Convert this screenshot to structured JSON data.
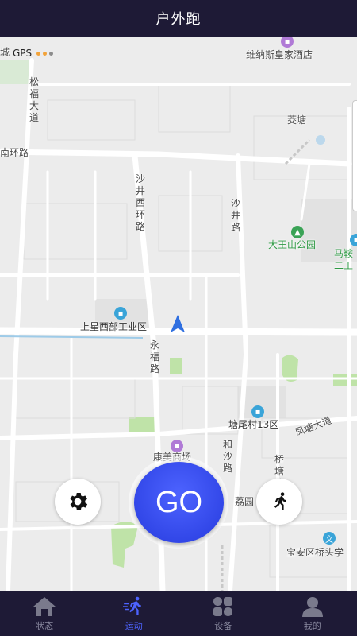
{
  "header": {
    "title": "户外跑"
  },
  "gps": {
    "label": "GPS",
    "dots": [
      "#f2a33a",
      "#f2a33a",
      "#8c8c8c"
    ]
  },
  "map": {
    "labels": {
      "hotel": "维纳斯皇家酒店",
      "songfu": "松福大道",
      "jiaotang": "茭塘",
      "nanhuan": "南环路",
      "shajingxihuan": "沙井西环路",
      "shajinglu": "沙井路",
      "dawangshan": "大王山公园",
      "maan": "马鞍",
      "er": "二工",
      "shangxing": "上星西部工业区",
      "yongfu": "永福路",
      "tangwei": "塘尾村13区",
      "fengtang": "凤塘大道",
      "heshalu": "和沙路",
      "qiaotang": "桥塘路",
      "kangmei": "康美商场",
      "liyuan": "荔园",
      "baoan": "宝安区桥头学",
      "cheng": "城"
    }
  },
  "colors": {
    "accent": "#3a4ff0",
    "bar_bg": "#1e1a36",
    "tab_inactive": "#8a8aa0"
  },
  "controls": {
    "go_label": "GO",
    "settings_icon": "gear-icon",
    "run_icon": "runner-icon"
  },
  "tabs": [
    {
      "label": "状态",
      "icon": "home-icon",
      "active": false
    },
    {
      "label": "运动",
      "icon": "runner-icon",
      "active": true
    },
    {
      "label": "设备",
      "icon": "device-grid-icon",
      "active": false
    },
    {
      "label": "我的",
      "icon": "user-icon",
      "active": false
    }
  ]
}
